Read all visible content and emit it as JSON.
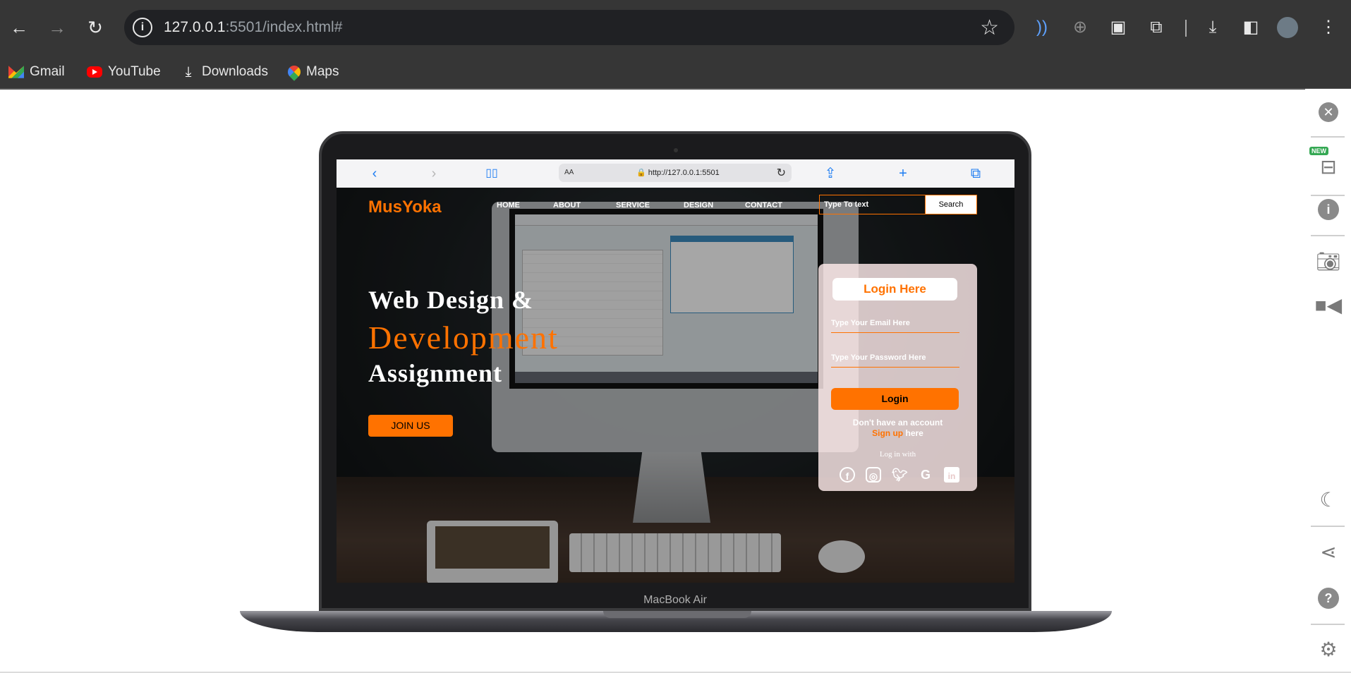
{
  "browser": {
    "url_host": "127.0.0.1",
    "url_rest": ":5501/index.html#",
    "bookmarks": [
      {
        "label": "Gmail",
        "icon": "gmail-icon"
      },
      {
        "label": "YouTube",
        "icon": "youtube-icon"
      },
      {
        "label": "Downloads",
        "icon": "download-icon"
      },
      {
        "label": "Maps",
        "icon": "maps-icon"
      }
    ]
  },
  "side_panel": {
    "new_badge": "NEW",
    "items": [
      "close-icon",
      "responsive-devices-icon",
      "info-icon",
      "camera-icon",
      "video-icon",
      "dark-mode-icon",
      "share-icon",
      "help-icon",
      "settings-icon"
    ]
  },
  "device": {
    "label": "MacBook Air",
    "safari_aa": "AA",
    "safari_url": "http://127.0.0.1:5501"
  },
  "site": {
    "logo": "MusYoka",
    "nav": [
      "HOME",
      "ABOUT",
      "SERVICE",
      "DESIGN",
      "CONTACT"
    ],
    "search_placeholder": "Type To text",
    "search_button": "Search",
    "hero": {
      "line1": "Web Design &",
      "line2": "Development",
      "line3": "Assignment"
    },
    "join_button": "JOIN US",
    "login": {
      "title": "Login Here",
      "email_placeholder": "Type Your Email Here",
      "password_placeholder": "Type Your Password Here",
      "button": "Login",
      "no_account": "Don't have an account",
      "sign_up": "Sign up",
      "here": "here",
      "log_in_with": "Log in with",
      "socials": [
        "facebook-icon",
        "instagram-icon",
        "twitter-icon",
        "google-icon",
        "linkedin-icon"
      ]
    }
  },
  "colors": {
    "accent": "#ff7200",
    "chrome_bg": "#363636"
  }
}
